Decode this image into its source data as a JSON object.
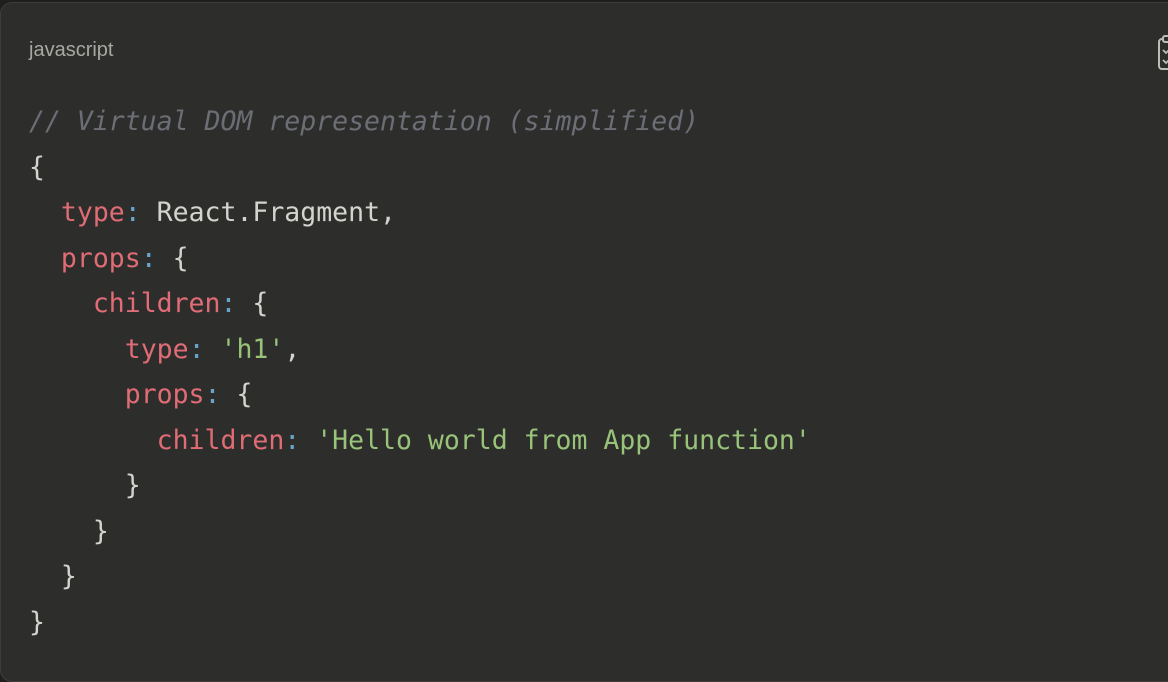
{
  "code_block": {
    "language": "javascript",
    "copy_icon": "clipboard-icon",
    "colors": {
      "background": "#2d2d2c",
      "comment": "#6c6e75",
      "key": "#e06c75",
      "string": "#98c379",
      "punctuation": "#6aa3c8",
      "text": "#d4d4cf"
    },
    "lines": [
      [
        {
          "t": "cm",
          "v": "// Virtual DOM representation (simplified)"
        }
      ],
      [
        {
          "t": "plain",
          "v": "{"
        }
      ],
      [
        {
          "t": "plain",
          "v": "  "
        },
        {
          "t": "key",
          "v": "type"
        },
        {
          "t": "punc",
          "v": ":"
        },
        {
          "t": "plain",
          "v": " React.Fragment,"
        }
      ],
      [
        {
          "t": "plain",
          "v": "  "
        },
        {
          "t": "key",
          "v": "props"
        },
        {
          "t": "punc",
          "v": ":"
        },
        {
          "t": "plain",
          "v": " {"
        }
      ],
      [
        {
          "t": "plain",
          "v": "    "
        },
        {
          "t": "key",
          "v": "children"
        },
        {
          "t": "punc",
          "v": ":"
        },
        {
          "t": "plain",
          "v": " {"
        }
      ],
      [
        {
          "t": "plain",
          "v": "      "
        },
        {
          "t": "key",
          "v": "type"
        },
        {
          "t": "punc",
          "v": ":"
        },
        {
          "t": "plain",
          "v": " "
        },
        {
          "t": "str",
          "v": "'h1'"
        },
        {
          "t": "plain",
          "v": ","
        }
      ],
      [
        {
          "t": "plain",
          "v": "      "
        },
        {
          "t": "key",
          "v": "props"
        },
        {
          "t": "punc",
          "v": ":"
        },
        {
          "t": "plain",
          "v": " {"
        }
      ],
      [
        {
          "t": "plain",
          "v": "        "
        },
        {
          "t": "key",
          "v": "children"
        },
        {
          "t": "punc",
          "v": ":"
        },
        {
          "t": "plain",
          "v": " "
        },
        {
          "t": "str",
          "v": "'Hello world from App function'"
        }
      ],
      [
        {
          "t": "plain",
          "v": "      }"
        }
      ],
      [
        {
          "t": "plain",
          "v": "    }"
        }
      ],
      [
        {
          "t": "plain",
          "v": "  }"
        }
      ],
      [
        {
          "t": "plain",
          "v": "}"
        }
      ]
    ]
  }
}
